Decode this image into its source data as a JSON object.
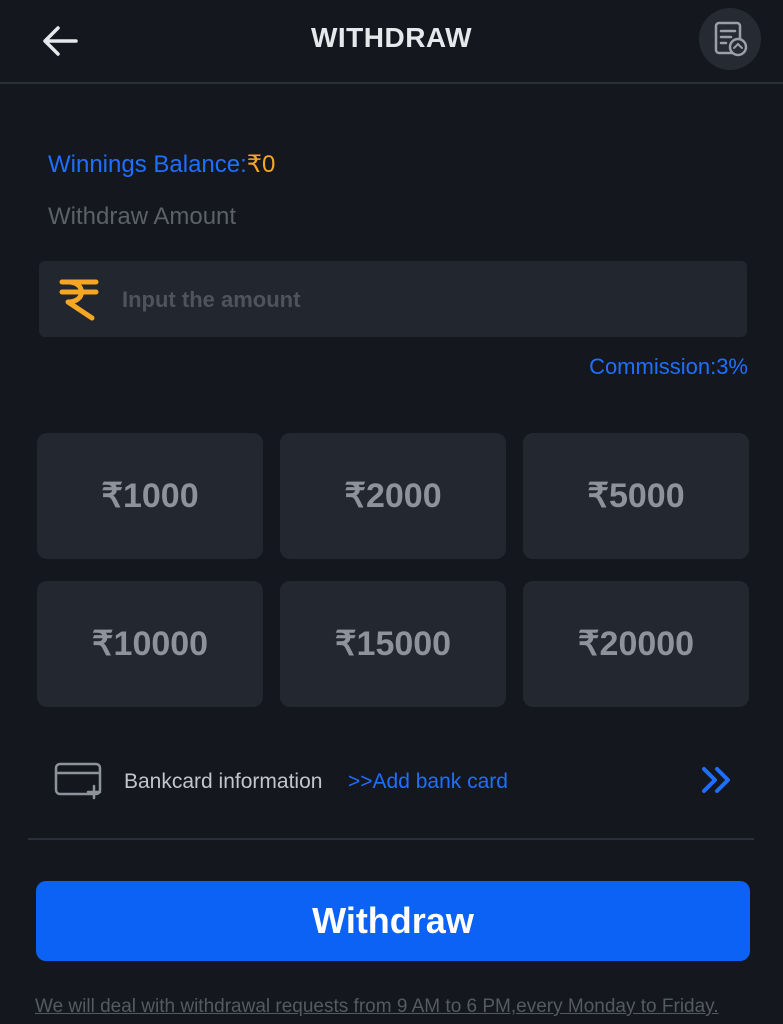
{
  "header": {
    "title": "WITHDRAW",
    "back_icon": "arrow-left-icon",
    "history_icon": "withdraw-history-icon"
  },
  "balance": {
    "label": "Winnings Balance:",
    "value": "₹0"
  },
  "amount": {
    "label": "Withdraw Amount",
    "placeholder": "Input the amount",
    "value": "",
    "currency_icon": "rupee-icon"
  },
  "commission": "Commission:3%",
  "quick_amounts": [
    "₹1000",
    "₹2000",
    "₹5000",
    "₹10000",
    "₹15000",
    "₹20000"
  ],
  "bank": {
    "icon": "add-card-icon",
    "label": "Bankcard information",
    "add_link": ">>Add bank card",
    "chevron_icon": "double-chevron-right-icon"
  },
  "withdraw_button": "Withdraw",
  "notice": "We will deal with withdrawal requests from 9 AM to 6 PM,every Monday to Friday.",
  "colors": {
    "background": "#14171e",
    "accent_blue": "#0b62f5",
    "link_blue": "#1f6fff",
    "gold": "#f5a623"
  }
}
